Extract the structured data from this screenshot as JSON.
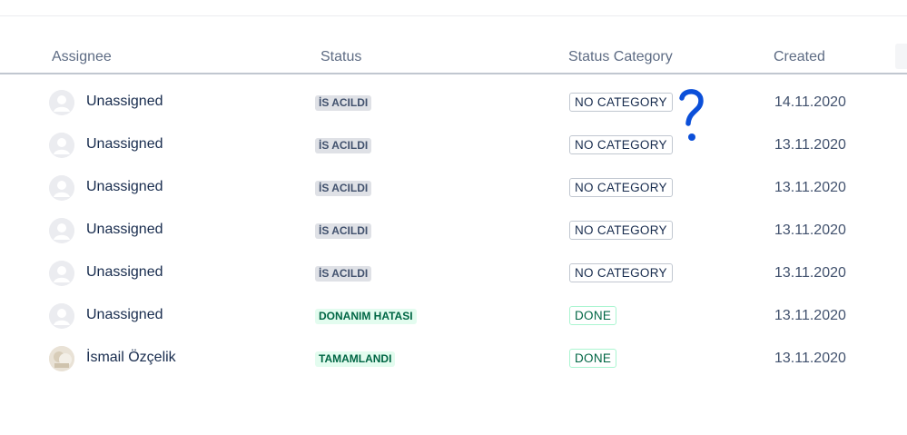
{
  "table": {
    "headers": {
      "assignee": "Assignee",
      "status": "Status",
      "status_category": "Status Category",
      "created": "Created"
    },
    "rows": [
      {
        "assignee": "Unassigned",
        "avatar": "default-avatar-icon",
        "status": "İS ACILDI",
        "status_style": "default",
        "category": "NO CATEGORY",
        "category_style": "none",
        "created": "14.11.2020"
      },
      {
        "assignee": "Unassigned",
        "avatar": "default-avatar-icon",
        "status": "İS ACILDI",
        "status_style": "default",
        "category": "NO CATEGORY",
        "category_style": "none",
        "created": "13.11.2020"
      },
      {
        "assignee": "Unassigned",
        "avatar": "default-avatar-icon",
        "status": "İS ACILDI",
        "status_style": "default",
        "category": "NO CATEGORY",
        "category_style": "none",
        "created": "13.11.2020"
      },
      {
        "assignee": "Unassigned",
        "avatar": "default-avatar-icon",
        "status": "İS ACILDI",
        "status_style": "default",
        "category": "NO CATEGORY",
        "category_style": "none",
        "created": "13.11.2020"
      },
      {
        "assignee": "Unassigned",
        "avatar": "default-avatar-icon",
        "status": "İS ACILDI",
        "status_style": "default",
        "category": "NO CATEGORY",
        "category_style": "none",
        "created": "13.11.2020"
      },
      {
        "assignee": "Unassigned",
        "avatar": "default-avatar-icon",
        "status": "DONANIM HATASI",
        "status_style": "success",
        "category": "DONE",
        "category_style": "done",
        "created": "13.11.2020"
      },
      {
        "assignee": "İsmail Özçelik",
        "avatar": "user-photo-avatar",
        "status": "TAMAMLANDI",
        "status_style": "success",
        "category": "DONE",
        "category_style": "done",
        "created": "13.11.2020"
      }
    ]
  },
  "annotation": {
    "icon": "question-mark-icon",
    "color": "#0b4fd9"
  },
  "colors": {
    "header_text": "#5e6c84",
    "status_default_bg": "#dfe1e6",
    "status_success_bg": "#e3fcef",
    "success_text": "#006644"
  }
}
